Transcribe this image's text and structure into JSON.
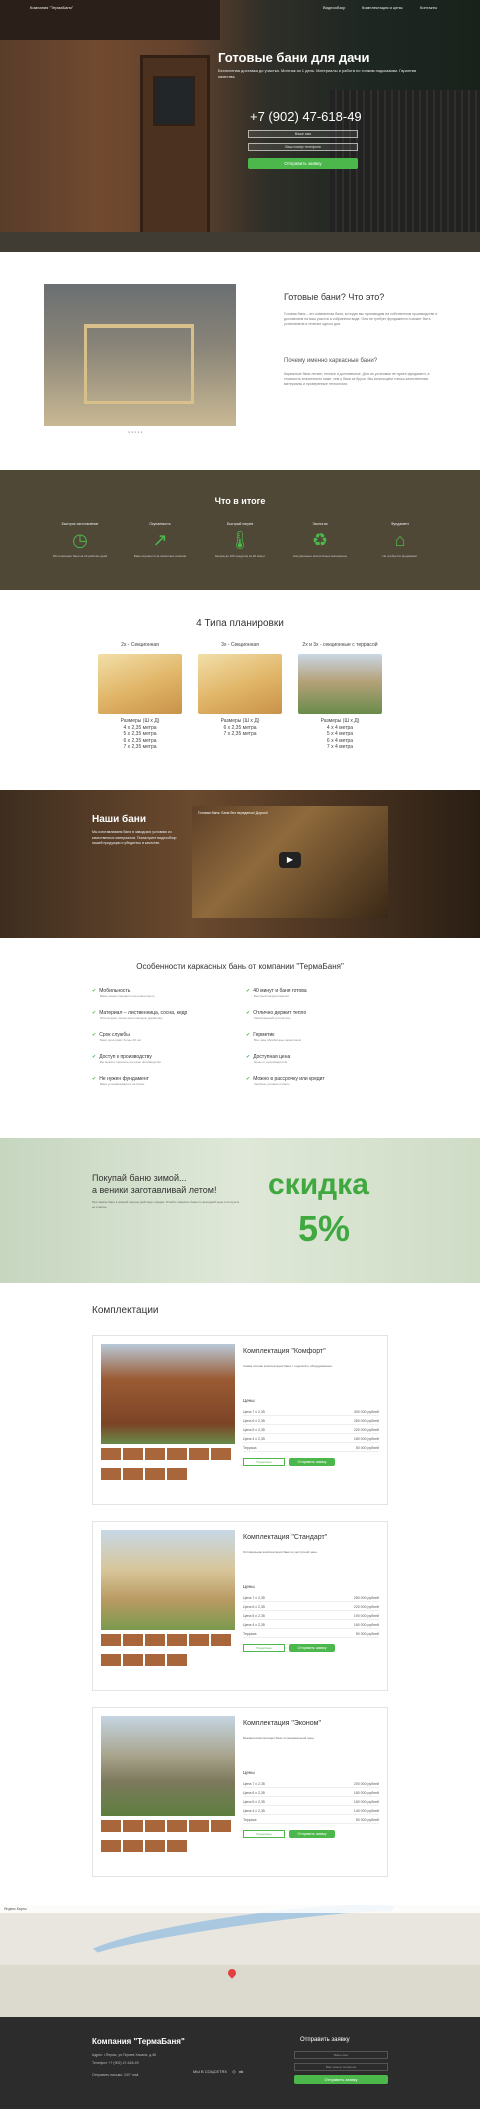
{
  "nav": {
    "brand": "Компания \"ТермаБаня\"",
    "links": [
      "Видеообзор",
      "Комплектация и цены",
      "Контакты"
    ]
  },
  "hero": {
    "title": "Готовые бани для дачи",
    "subtitle": "Бесплатная доставка до участка. Монтаж за 1 день. Материалы и работа по тонким подсказкам. Гарантия качества.",
    "phone": "+7 (902) 47-618-49",
    "name_placeholder": "Ваше имя",
    "phone_placeholder": "Ваш номер телефона",
    "button": "Отправить заявку"
  },
  "about": {
    "title": "Готовые бани? Что это?",
    "text": "Готовая баня – это компактная баня, которую мы производим на собственном производстве и доставляем на ваш участок в собранном виде. Она не требует фундамента и может быть установлена в течение одного дня.",
    "subtitle": "Почему именно каркасные бани?",
    "text2": "Каркасные бани легкие, теплые и долговечные. Для их установки не нужен фундамент, а стоимость значительно ниже, чем у бани из бруса. Мы используем только качественные материалы и проверенные технологии.",
    "dots": "● ● ● ● ●"
  },
  "results": {
    "title": "Что в итоге",
    "items": [
      {
        "title": "Быстрое изготовление",
        "icon": "clock-icon",
        "glyph": "◷",
        "desc": "Изготовление бани за 14 рабочих дней"
      },
      {
        "title": "Окупаемость",
        "icon": "chart-icon",
        "glyph": "↗",
        "desc": "Баня окупается за несколько сезонов"
      },
      {
        "title": "Быстрый нагрев",
        "icon": "thermometer-icon",
        "glyph": "🌡",
        "desc": "Нагрев до 100 градусов за 40 минут"
      },
      {
        "title": "Экология",
        "icon": "recycle-icon",
        "glyph": "♻",
        "desc": "Натуральные экологичные материалы"
      },
      {
        "title": "Фундамент",
        "icon": "house-icon",
        "glyph": "⌂",
        "desc": "Не требуется фундамент"
      }
    ]
  },
  "plans": {
    "title": "4 Типа планировки",
    "items": [
      {
        "title": "2х - Секционная",
        "size_label": "Размеры (Ш х Д)",
        "sizes": [
          "4 х 2,35 метра",
          "5 х 2,35 метра",
          "6 х 2,35 метра",
          "7 х 2,35 метра"
        ]
      },
      {
        "title": "3х - Секционная",
        "size_label": "Размеры (Ш х Д)",
        "sizes": [
          "6 х 2,35 метра",
          "7 х 2,35 метра"
        ]
      },
      {
        "title": "2х и 3х - секционные с террасой",
        "size_label": "Размеры (Ш х Д)",
        "sizes": [
          "4 х 4 метра",
          "5 х 4 метра",
          "6 х 4 метра",
          "7 х 4 метра"
        ]
      }
    ]
  },
  "video": {
    "title": "Наши бани",
    "text": "Мы изготавливаем бани в заводских условиях из качественных материалов. Посмотрите видеообзор нашей продукции и убедитесь в качестве.",
    "video_title": "Готовая баня. Баня без переделок! Дорого!",
    "play": "▶"
  },
  "features": {
    "title": "Особенности каркасных бань от компании \"ТермаБаня\"",
    "items": [
      {
        "title": "Мобильность",
        "desc": "Баню можно перевезти на новое место"
      },
      {
        "title": "40 минут и баня готова",
        "desc": "Быстрый нагрев парилки"
      },
      {
        "title": "Материал – лиственница, сосна, кедр",
        "desc": "Используем только качественную древесину"
      },
      {
        "title": "Отлично держит тепло",
        "desc": "Качественный утеплитель"
      },
      {
        "title": "Срок службы",
        "desc": "Баня прослужит более 20 лет"
      },
      {
        "title": "Герметик",
        "desc": "Все швы обработаны герметиком"
      },
      {
        "title": "Доступ к производству",
        "desc": "Вы можете приехать на наше производство"
      },
      {
        "title": "Доступная цена",
        "desc": "Цены от производителя"
      },
      {
        "title": "Не нужен фундамент",
        "desc": "Баня устанавливается на блоки"
      },
      {
        "title": "Можно в рассрочку или кредит",
        "desc": "Удобные условия оплаты"
      }
    ]
  },
  "promo": {
    "line1": "Покупай баню зимой...",
    "line2": "а веники заготавливай летом!",
    "text": "При заказе бани в зимний период действует скидка. Успейте заказать баню по выгодной цене и получите ее к весне.",
    "discount": "скидка",
    "percent": "5%"
  },
  "kits": {
    "title": "Комплектации",
    "prices_label": "Цены",
    "btn_more": "Подробнее",
    "btn_order": "Отправить заявку",
    "items": [
      {
        "title": "Комплектация \"Комфорт\"",
        "desc": "Самая полная комплектация бани с отделкой и оборудованием.",
        "prices": [
          [
            "Цена 7 х 2,35",
            "300 000 рублей"
          ],
          [
            "Цена 6 х 2,35",
            "260 000 рублей"
          ],
          [
            "Цена 5 х 2,35",
            "220 000 рублей"
          ],
          [
            "Цена 4 х 2,35",
            "180 000 рублей"
          ],
          [
            "Терраса",
            "50 000 рублей"
          ]
        ]
      },
      {
        "title": "Комплектация \"Стандарт\"",
        "desc": "Оптимальная комплектация бани по доступной цене.",
        "prices": [
          [
            "Цена 7 х 2,35",
            "250 000 рублей"
          ],
          [
            "Цена 6 х 2,35",
            "220 000 рублей"
          ],
          [
            "Цена 5 х 2,35",
            "190 000 рублей"
          ],
          [
            "Цена 4 х 2,35",
            "160 000 рублей"
          ],
          [
            "Терраса",
            "50 000 рублей"
          ]
        ]
      },
      {
        "title": "Комплектация \"Эконом\"",
        "desc": "Базовая комплектация бани по минимальной цене.",
        "prices": [
          [
            "Цена 7 х 2,35",
            "200 000 рублей"
          ],
          [
            "Цена 6 х 2,35",
            "180 000 рублей"
          ],
          [
            "Цена 5 х 2,35",
            "160 000 рублей"
          ],
          [
            "Цена 4 х 2,35",
            "140 000 рублей"
          ],
          [
            "Терраса",
            "50 000 рублей"
          ]
        ]
      }
    ]
  },
  "map": {
    "bar": "Яндекс Карты"
  },
  "footer": {
    "name": "Компания \"ТермаБаня\"",
    "address": "Адрес: г.Пермь, ул.Героев Хасана, д.46",
    "phone": "Телефон: +7 (902) 47-618-49",
    "time": "Отправить письмо: 24/7 mail",
    "social": "МЫ В СОЦСЕТЯХ",
    "form_title": "Отправить заявку",
    "name_placeholder": "Ваше имя",
    "phone_placeholder": "Ваш номер телефона",
    "button": "Отправить заявку"
  }
}
